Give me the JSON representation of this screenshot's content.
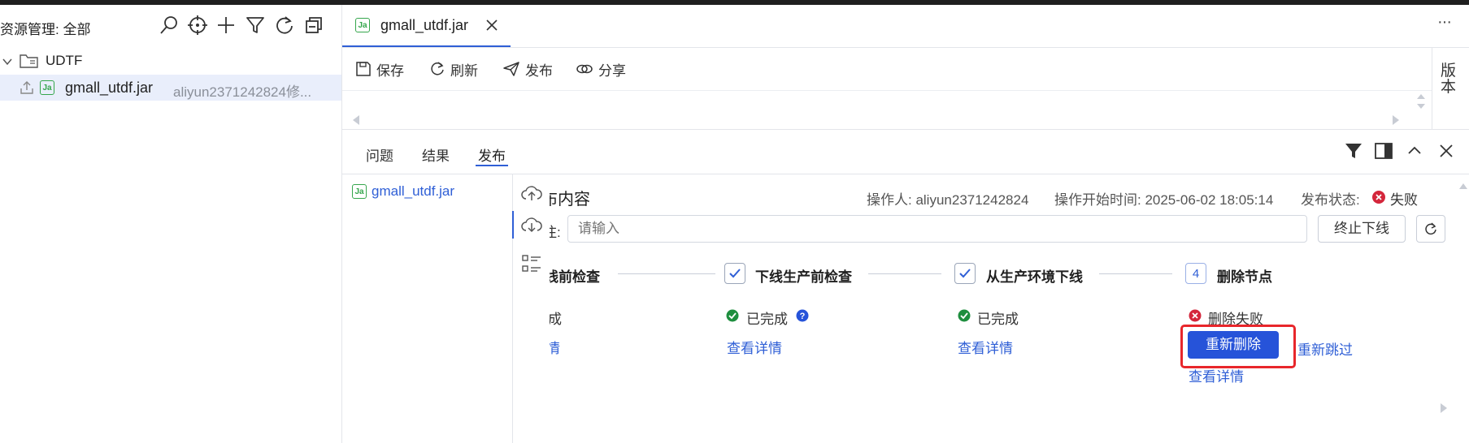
{
  "sidebar": {
    "title": "资源管理: 全部",
    "tree": {
      "folder_label": "UDTF",
      "file_label": "gmall_utdf.jar",
      "file_meta": "aliyun2371242824修..."
    }
  },
  "editor": {
    "tab_label": "gmall_utdf.jar",
    "file_badge": "Ja",
    "more": "···",
    "toolbar": {
      "save": "保存",
      "refresh": "刷新",
      "publish": "发布",
      "share": "分享"
    },
    "version_label": "版本"
  },
  "bottom_panel": {
    "tabs": [
      "问题",
      "结果",
      "发布"
    ],
    "active_tab": "发布",
    "file_item": "gmall_utdf.jar",
    "publish": {
      "heading": "布内容",
      "operator": "操作人: aliyun2371242824",
      "start_time": "操作开始时间: 2025-06-02 18:05:14",
      "status_label": "发布状态:",
      "status_value": "失败",
      "remark_prefix": "注:",
      "input_placeholder": "请输入",
      "stop_button": "终止下线",
      "steps": [
        {
          "title": "线前检查",
          "status": "成",
          "link": "情"
        },
        {
          "title": "下线生产前检查",
          "status": "已完成",
          "link": "查看详情"
        },
        {
          "title": "从生产环境下线",
          "status": "已完成",
          "link": "查看详情"
        },
        {
          "number": "4",
          "title": "删除节点",
          "status": "删除失败",
          "link": "查看详情"
        }
      ],
      "retry_delete": "重新删除",
      "retry_skip": "重新跳过"
    }
  },
  "colors": {
    "accent": "#2f5fd6",
    "success": "#1e8e3e",
    "error": "#d4263b",
    "highlight_box": "#e8262b"
  }
}
